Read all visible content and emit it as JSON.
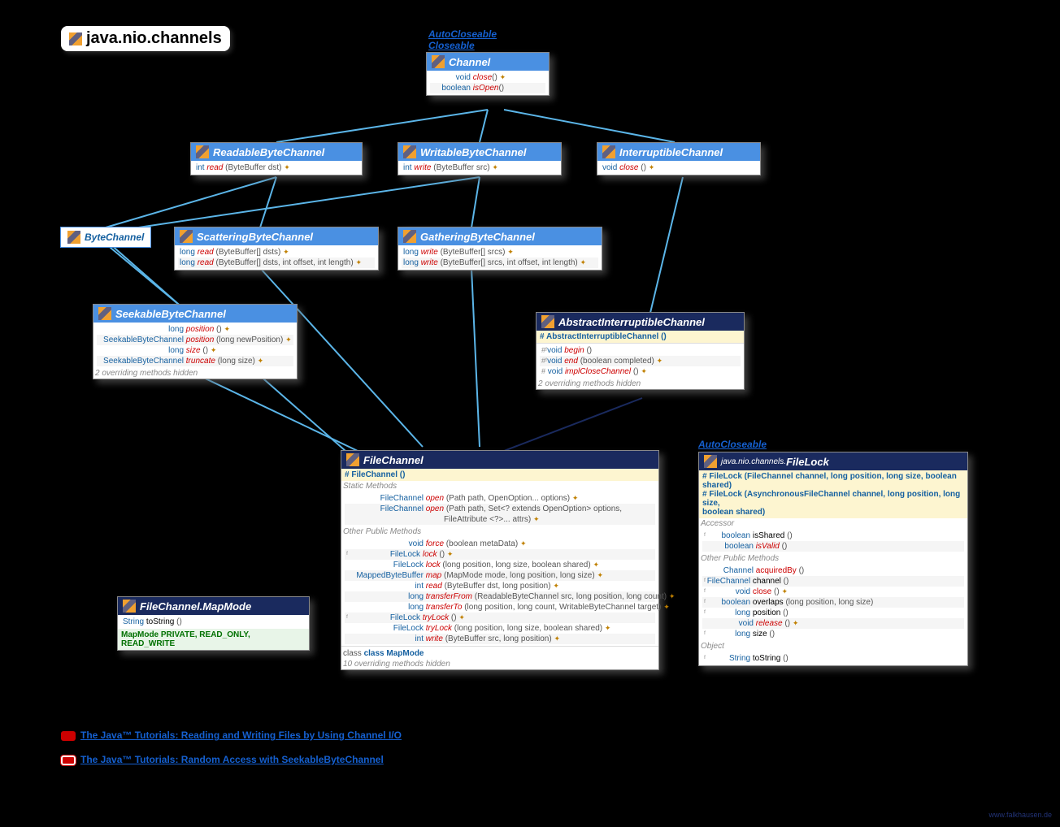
{
  "title": "java.nio.channels",
  "supers_channel": [
    "AutoCloseable",
    "Closeable"
  ],
  "supers_filelock": [
    "AutoCloseable"
  ],
  "links": [
    "The Java™ Tutorials: Reading and Writing Files by Using Channel I/O",
    "The Java™ Tutorials: Random Access with SeekableByteChannel"
  ],
  "attrib": "www.falkhausen.de",
  "boxes": {
    "channel": {
      "title": "Channel",
      "methods": [
        {
          "ret": "void",
          "name": "close",
          "params": "()",
          "ex": "✦"
        },
        {
          "ret": "boolean",
          "name": "isOpen",
          "params": "()",
          "cls": "name"
        }
      ]
    },
    "readable": {
      "title": "ReadableByteChannel",
      "methods": [
        {
          "ret": "int",
          "name": "read",
          "params": "(ByteBuffer dst)",
          "ex": "✦"
        }
      ]
    },
    "writable": {
      "title": "WritableByteChannel",
      "methods": [
        {
          "ret": "int",
          "name": "write",
          "params": "(ByteBuffer src)",
          "ex": "✦"
        }
      ]
    },
    "interruptible": {
      "title": "InterruptibleChannel",
      "methods": [
        {
          "ret": "void",
          "name": "close",
          "params": "()",
          "ex": "✦"
        }
      ]
    },
    "bytechannel": {
      "title": "ByteChannel"
    },
    "scattering": {
      "title": "ScatteringByteChannel",
      "methods": [
        {
          "ret": "long",
          "name": "read",
          "params": "(ByteBuffer[] dsts)",
          "ex": "✦"
        },
        {
          "ret": "long",
          "name": "read",
          "params": "(ByteBuffer[] dsts, int offset, int length)",
          "ex": "✦"
        }
      ]
    },
    "gathering": {
      "title": "GatheringByteChannel",
      "methods": [
        {
          "ret": "long",
          "name": "write",
          "params": "(ByteBuffer[] srcs)",
          "ex": "✦"
        },
        {
          "ret": "long",
          "name": "write",
          "params": "(ByteBuffer[] srcs, int offset, int length)",
          "ex": "✦"
        }
      ]
    },
    "seekable": {
      "title": "SeekableByteChannel",
      "methods": [
        {
          "ret": "long",
          "name": "position",
          "params": "()",
          "ex": "✦"
        },
        {
          "ret": "SeekableByteChannel",
          "name": "position",
          "params": "(long newPosition)",
          "ex": "✦"
        },
        {
          "ret": "long",
          "name": "size",
          "params": "()",
          "ex": "✦"
        },
        {
          "ret": "SeekableByteChannel",
          "name": "truncate",
          "params": "(long size)",
          "ex": "✦"
        }
      ],
      "footer": "2 overriding methods hidden"
    },
    "absinterrupt": {
      "title": "AbstractInterruptibleChannel",
      "ctor": "# AbstractInterruptibleChannel ()",
      "methods": [
        {
          "pre": "#ᶠ",
          "ret": "void",
          "name": "begin",
          "params": "()"
        },
        {
          "pre": "#ᶠ",
          "ret": "void",
          "name": "end",
          "params": "(boolean completed)",
          "ex": "✦"
        },
        {
          "pre": "#",
          "ret": "void",
          "name": "implCloseChannel",
          "params": "()",
          "ex": "✦"
        }
      ],
      "footer": "2 overriding methods hidden"
    },
    "filechannel": {
      "title": "FileChannel",
      "ctor": "# FileChannel ()",
      "static": [
        {
          "ret": "FileChannel",
          "name": "open",
          "params": "(Path path, OpenOption... options)",
          "ex": "✦"
        },
        {
          "ret": "FileChannel",
          "name": "open",
          "params": "(Path path, Set<? extends OpenOption> options,",
          "cont": "FileAttribute <?>... attrs)",
          "ex": "✦"
        }
      ],
      "other": [
        {
          "ret": "void",
          "name": "force",
          "params": "(boolean metaData)",
          "ex": "✦"
        },
        {
          "pre": "ᶠ",
          "ret": "FileLock",
          "name": "lock",
          "params": "()",
          "ex": "✦"
        },
        {
          "ret": "FileLock",
          "name": "lock",
          "params": "(long position, long size, boolean shared)",
          "ex": "✦"
        },
        {
          "ret": "MappedByteBuffer",
          "name": "map",
          "params": "(MapMode mode, long position, long size)",
          "ex": "✦"
        },
        {
          "ret": "int",
          "name": "read",
          "params": "(ByteBuffer dst, long position)",
          "ex": "✦"
        },
        {
          "ret": "long",
          "name": "transferFrom",
          "params": "(ReadableByteChannel src, long position, long count)",
          "ex": "✦"
        },
        {
          "ret": "long",
          "name": "transferTo",
          "params": "(long position, long count, WritableByteChannel target)",
          "ex": "✦"
        },
        {
          "pre": "ᶠ",
          "ret": "FileLock",
          "name": "tryLock",
          "params": "()",
          "ex": "✦"
        },
        {
          "ret": "FileLock",
          "name": "tryLock",
          "params": "(long position, long size, boolean shared)",
          "ex": "✦"
        },
        {
          "ret": "int",
          "name": "write",
          "params": "(ByteBuffer src, long position)",
          "ex": "✦"
        }
      ],
      "classline": "class MapMode",
      "footer": "10 overriding methods hidden"
    },
    "mapmode": {
      "title": "FileChannel.MapMode",
      "methods": [
        {
          "ret": "String",
          "name": "toString",
          "params": "()",
          "cls": "plain"
        }
      ],
      "vals": "MapMode PRIVATE, READ_ONLY, READ_WRITE"
    },
    "filelock": {
      "pkg": "java.nio.channels.",
      "title": "FileLock",
      "ctors": [
        "# FileLock (FileChannel channel, long position, long size, boolean shared)",
        "# FileLock (AsynchronousFileChannel channel, long position, long size,",
        "         boolean shared)"
      ],
      "accessor": [
        {
          "pre": "ᶠ",
          "ret": "boolean",
          "name": "isShared",
          "params": "()"
        },
        {
          "ret": "boolean",
          "name": "isValid",
          "params": "()",
          "cls": "name"
        }
      ],
      "other": [
        {
          "ret": "Channel",
          "name": "acquiredBy",
          "params": "()"
        },
        {
          "pre": "ᶠ",
          "ret": "FileChannel",
          "name": "channel",
          "params": "()"
        },
        {
          "pre": "ᶠ",
          "ret": "void",
          "name": "close",
          "params": "()",
          "ex": "✦"
        },
        {
          "pre": "ᶠ",
          "ret": "boolean",
          "name": "overlaps",
          "params": "(long position, long size)"
        },
        {
          "pre": "ᶠ",
          "ret": "long",
          "name": "position",
          "params": "()"
        },
        {
          "ret": "void",
          "name": "release",
          "params": "()",
          "ex": "✦"
        },
        {
          "pre": "ᶠ",
          "ret": "long",
          "name": "size",
          "params": "()"
        }
      ],
      "object": [
        {
          "pre": "ᶠ",
          "ret": "String",
          "name": "toString",
          "params": "()",
          "cls": "plain"
        }
      ]
    }
  }
}
